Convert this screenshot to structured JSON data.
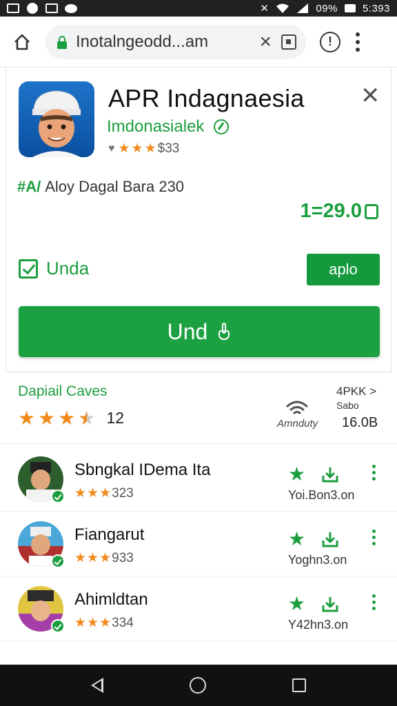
{
  "status_bar": {
    "battery_percent": "09%",
    "time": "5:393"
  },
  "browser": {
    "url": "Inotalngeodd...am"
  },
  "app": {
    "title": "APR Indagnaesia",
    "developer": "Imdonasialek",
    "rating_text": "$33",
    "meta_tag": "#A/",
    "meta_text": "Aloy Dagal Bara 230",
    "price": "1=29.0",
    "checkbox_label": "Unda",
    "small_button_label": "aplo",
    "install_button_label": "Und"
  },
  "details": {
    "label": "Dapiail Caves",
    "star_rating": 3.5,
    "rating_count": "12",
    "brand": "Amnduty",
    "apk_link": "4PKK >",
    "apk_sub": "Sabo",
    "apk_size": "16.0B"
  },
  "list": [
    {
      "title": "Sbngkal IDema Ita",
      "rating": "323",
      "size": "Yoi.Bon3.on",
      "stars": 3
    },
    {
      "title": "Fiangarut",
      "rating": "933",
      "size": "Yoghn3.on",
      "stars": 3
    },
    {
      "title": "Ahimldtan",
      "rating": "334",
      "size": "Y42hn3.on",
      "stars": 3
    }
  ],
  "colors": {
    "accent_green": "#1b9e3e",
    "star_orange": "#f08a1c",
    "status_bar": "#222222",
    "nav_bar": "#111111"
  },
  "icons": {
    "status_left": [
      "screen-cast-icon",
      "messenger-icon",
      "notification-icon",
      "chat-bubble-icon"
    ],
    "status_right": [
      "mute-icon",
      "wifi-icon",
      "signal-icon",
      "battery-icon"
    ],
    "browser": [
      "home-icon",
      "lock-icon",
      "close-icon",
      "tab-icon",
      "info-icon",
      "kebab-menu-icon"
    ]
  }
}
